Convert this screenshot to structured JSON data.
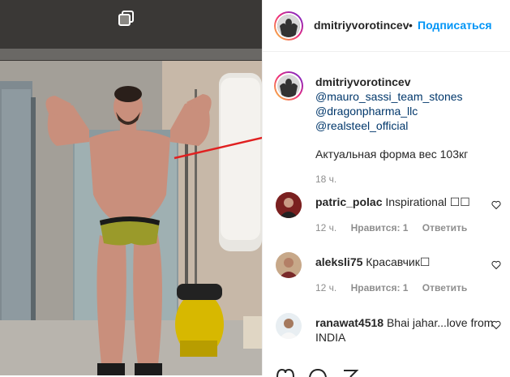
{
  "post": {
    "gallery_icon": "multiple-photos-icon",
    "arrow_color": "#e02020"
  },
  "header": {
    "username": "dmitriyvorotincev",
    "separator": "•",
    "follow_label": "Подписаться"
  },
  "caption": {
    "username": "dmitriyvorotincev",
    "mentions": [
      "@mauro_sassi_team_stones",
      "@dragonpharma_llc",
      "@realsteel_official"
    ],
    "text": "Актуальная форма вес 103кг",
    "time": "18 ч."
  },
  "comments": [
    {
      "username": "patric_polac",
      "text": "Inspirational ☐☐",
      "time": "12 ч.",
      "likes": "Нравится: 1",
      "reply": "Ответить"
    },
    {
      "username": "aleksli75",
      "text": "Красавчик☐",
      "time": "12 ч.",
      "likes": "Нравится: 1",
      "reply": "Ответить"
    },
    {
      "username": "ranawat4518",
      "text": "Bhai jahar...love from INDIA"
    }
  ],
  "actions": [
    "heart-icon",
    "comment-icon",
    "share-icon"
  ]
}
